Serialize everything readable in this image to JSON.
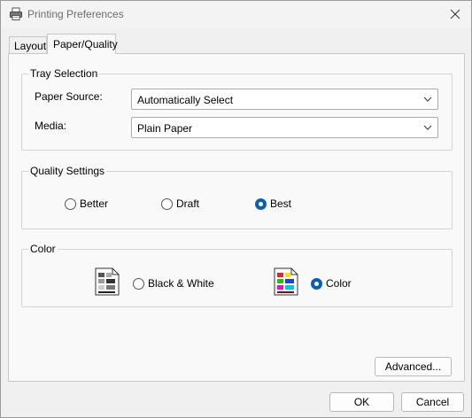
{
  "window": {
    "title": "Printing Preferences"
  },
  "tabs": [
    {
      "label": "Layout",
      "selected": false
    },
    {
      "label": "Paper/Quality",
      "selected": true
    }
  ],
  "tray_selection": {
    "title": "Tray Selection",
    "paper_source": {
      "label": "Paper Source:",
      "value": "Automatically Select"
    },
    "media": {
      "label": "Media:",
      "value": "Plain Paper"
    }
  },
  "quality_settings": {
    "title": "Quality Settings",
    "options": [
      {
        "label": "Better",
        "selected": false
      },
      {
        "label": "Draft",
        "selected": false
      },
      {
        "label": "Best",
        "selected": true
      }
    ]
  },
  "color": {
    "title": "Color",
    "options": [
      {
        "label": "Black & White",
        "selected": false
      },
      {
        "label": "Color",
        "selected": true
      }
    ]
  },
  "buttons": {
    "advanced": "Advanced...",
    "ok": "OK",
    "cancel": "Cancel"
  },
  "colors": {
    "accent": "#0a5fb4"
  },
  "icons": [
    "printer-icon",
    "close-icon",
    "chevron-down-icon",
    "bw-document-icon",
    "color-document-icon"
  ]
}
